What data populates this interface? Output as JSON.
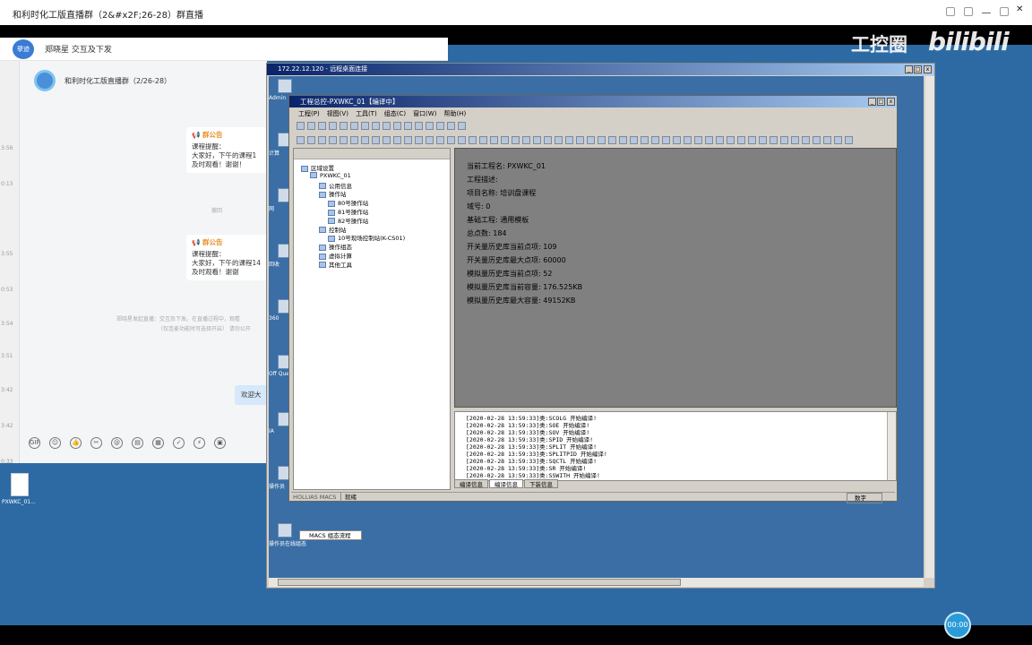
{
  "window": {
    "title": "和利时化工版直播群（2&#x2F;26-28）群直播"
  },
  "watermark": {
    "left": "工控圈",
    "right": "bilibili"
  },
  "player": {
    "time": "00:00"
  },
  "chat": {
    "tab_avatar": "孽迹",
    "tab_name": "郑晓星 交互及下发",
    "group_name": "和利时化工版直播群（2/26-28）",
    "strip_times": [
      "3:56",
      "0:13",
      "3:55",
      "0:53",
      "3:54",
      "3:51",
      "3:42",
      "3:42",
      "0:33"
    ],
    "notices": [
      {
        "title": "群公告",
        "lines": [
          "课程提醒：",
          "大家好，下午的课程1",
          "及时观看！谢谢！"
        ]
      },
      {
        "title": "群公告",
        "lines": [
          "课程提醒：",
          "大家好，下午的课程14",
          "及时观看！谢谢"
        ]
      }
    ],
    "muted1": "撤回",
    "muted2": "郑晓星发起直播：交互及下发。在直播过程中，观看",
    "muted3": "（仅连麦功能时可选择开启）  请勿公开",
    "bubble": "欢迎大",
    "tools": [
      "GIF",
      "☺",
      "👍",
      "✂",
      "@",
      "▤",
      "▦",
      "✓",
      "⚡",
      "▣"
    ]
  },
  "desktop": {
    "file_label": "PXWKC_01..."
  },
  "rdp": {
    "title": "172.22.12.120 - 远程桌面连接",
    "icons": [
      {
        "label": "Admin"
      },
      {
        "label": "计算"
      },
      {
        "label": "网"
      },
      {
        "label": "回收"
      },
      {
        "label": "360"
      },
      {
        "label": "Off Query"
      },
      {
        "label": "IA"
      },
      {
        "label": "操作员"
      },
      {
        "label": "操作员在线组态"
      }
    ]
  },
  "app": {
    "title": "工程总控-PXWKC_01【编译中】",
    "menu": [
      "工程(P)",
      "视图(V)",
      "工具(T)",
      "组态(C)",
      "窗口(W)",
      "帮助(H)"
    ],
    "tree": [
      {
        "label": "区域设置",
        "indent": 0
      },
      {
        "label": "PXWKC_01",
        "indent": 1
      },
      {
        "label": "公用信息",
        "indent": 2
      },
      {
        "label": "操作站",
        "indent": 2
      },
      {
        "label": "80号操作站",
        "indent": 3
      },
      {
        "label": "81号操作站",
        "indent": 3
      },
      {
        "label": "82号操作站",
        "indent": 3
      },
      {
        "label": "控制站",
        "indent": 2
      },
      {
        "label": "10号现场控制站(K-CS01)",
        "indent": 3
      },
      {
        "label": "操作组态",
        "indent": 2
      },
      {
        "label": "虚拟计算",
        "indent": 2
      },
      {
        "label": "其他工具",
        "indent": 2
      }
    ],
    "tree_tab": "MACS 组态流程",
    "info": [
      "当前工程名: PXWKC_01",
      "工程描述:",
      "项目名称: 培训盘课程",
      "域号: 0",
      "基础工程: 通用模板",
      "总点数: 184",
      "开关量历史库当前点项: 109",
      "开关量历史库最大点项: 60000",
      "模拟量历史库当前点项: 52",
      "模拟量历史库当前容量: 176.525KB",
      "模拟量历史库最大容量: 49152KB"
    ],
    "log": [
      "[2020-02-28 13:59:33]类:SCOLG 开始编译!",
      "[2020-02-28 13:59:33]类:SOE 开始编译!",
      "[2020-02-28 13:59:33]类:SOV 开始编译!",
      "[2020-02-28 13:59:33]类:SPID 开始编译!",
      "[2020-02-28 13:59:33]类:SPLIT 开始编译!",
      "[2020-02-28 13:59:33]类:SPLITPID 开始编译!",
      "[2020-02-28 13:59:33]类:SQCTL 开始编译!",
      "[2020-02-28 13:59:33]类:SR 开始编译!",
      "[2020-02-28 13:59:33]类:SSWITH 开始编译!"
    ],
    "log_tabs": [
      "编译信息",
      "编译信息",
      "下装信息"
    ],
    "status": {
      "left": "HOLLIAS MACS",
      "msg": "就绪",
      "mode": "数字"
    }
  }
}
